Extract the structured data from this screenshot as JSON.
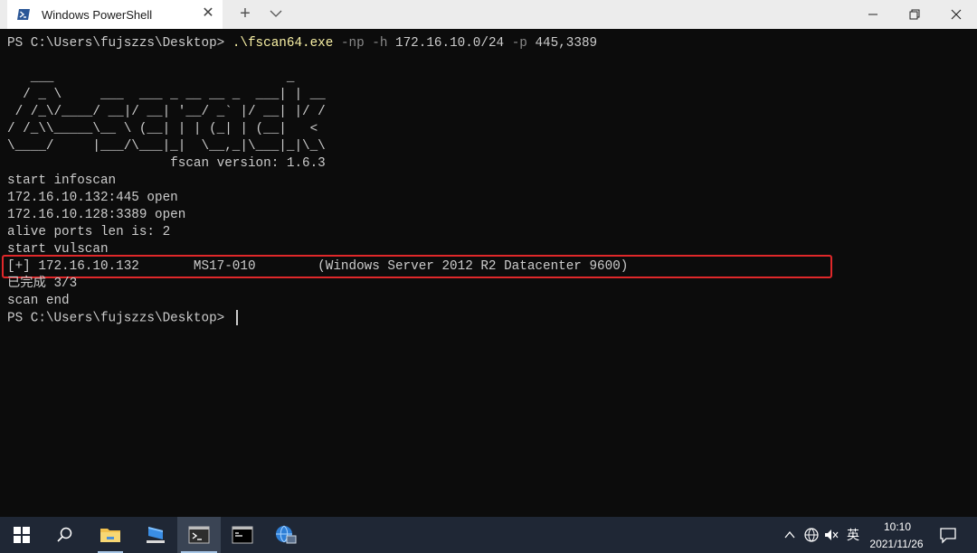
{
  "window": {
    "tab_title": "Windows PowerShell",
    "new_tab": "+",
    "close_tab": "✕"
  },
  "terminal": {
    "prompt1": "PS C:\\Users\\fujszzs\\Desktop> ",
    "cmd_exe": ".\\fscan64.exe",
    "cmd_np_flag": " -np",
    "cmd_h_flag": " -h",
    "cmd_h_value": " 172.16.10.0/24",
    "cmd_p_flag": " -p",
    "cmd_p_value": " 445,3389",
    "banner": [
      "   ___                              _    ",
      "  / _ \\     ___  ___ _ __ __ _  ___| | __ ",
      " / /_\\/____/ __|/ __| '__/ _` |/ __| |/ /",
      "/ /_\\\\_____\\__ \\ (__| | | (_| | (__|   <    ",
      "\\____/     |___/\\___|_|  \\__,_|\\___|_|\\_\\   "
    ],
    "version_line": "                     fscan version: 1.6.3",
    "output": [
      "start infoscan",
      "172.16.10.132:445 open",
      "172.16.10.128:3389 open",
      "alive ports len is: 2",
      "start vulscan"
    ],
    "vuln_line": "[+] 172.16.10.132       MS17-010        (Windows Server 2012 R2 Datacenter 9600)",
    "done_line": "已完成 3/3",
    "scan_end": "scan end",
    "prompt2": "PS C:\\Users\\fujszzs\\Desktop> "
  },
  "taskbar": {
    "input_method": "英",
    "time": "10:10",
    "date": "2021/11/26"
  },
  "colors": {
    "highlight_box": "#e0282a",
    "command_exe": "#f9f1a5",
    "command_flags": "#8a8a8a"
  }
}
